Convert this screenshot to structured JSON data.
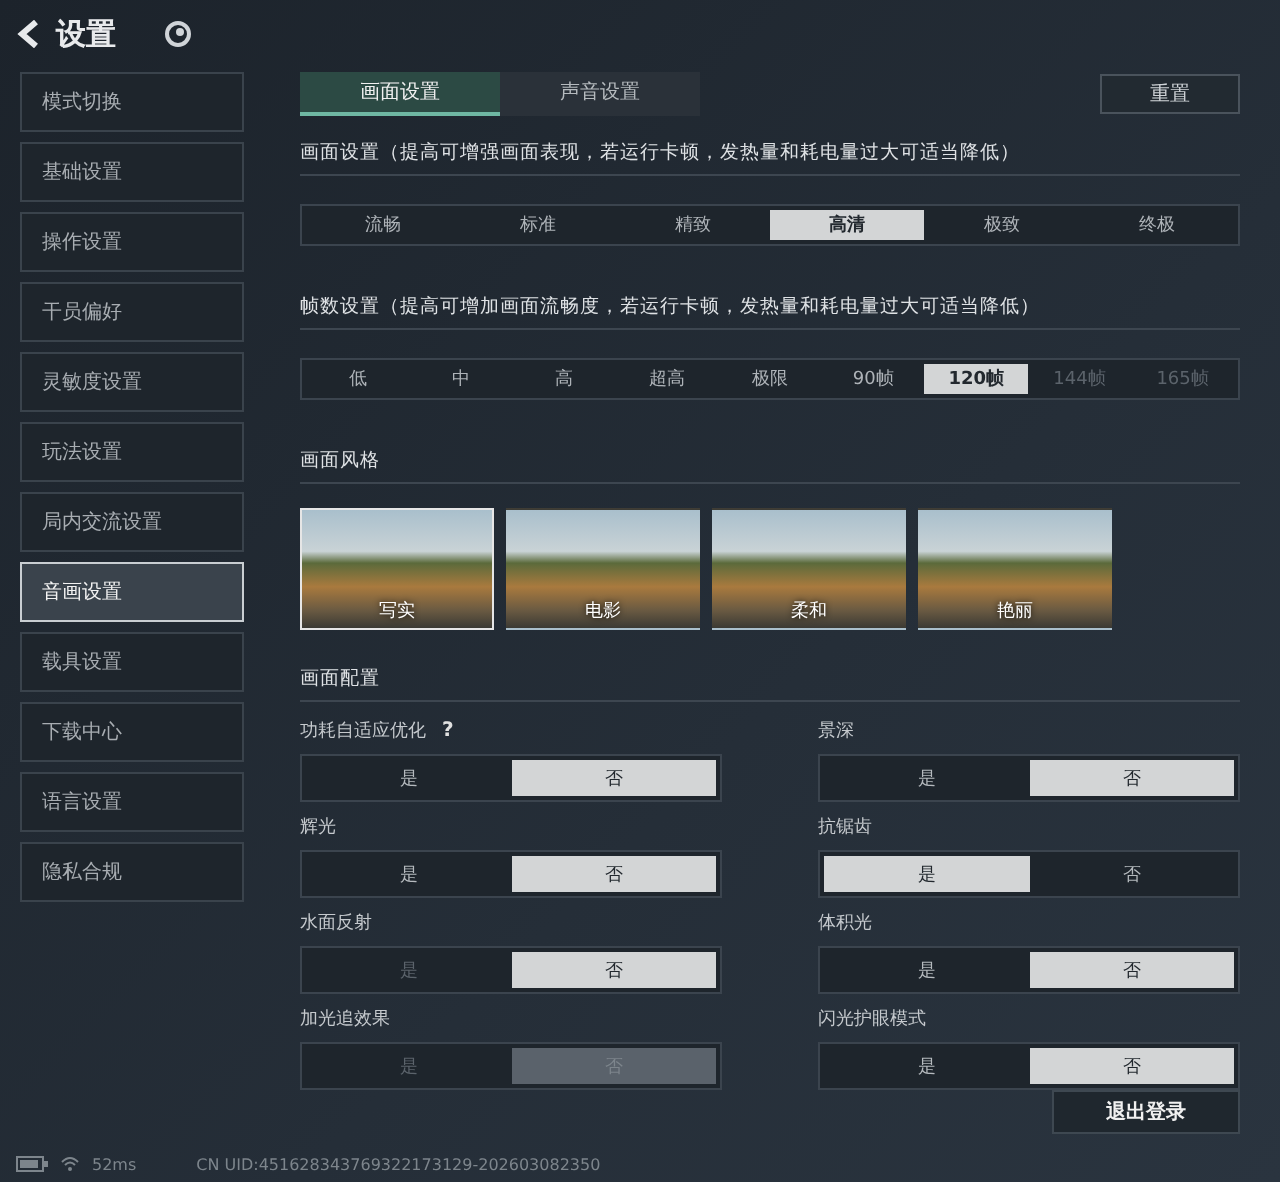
{
  "header": {
    "title": "设置"
  },
  "sidebar": {
    "items": [
      {
        "label": "模式切换",
        "selected": false
      },
      {
        "label": "基础设置",
        "selected": false
      },
      {
        "label": "操作设置",
        "selected": false
      },
      {
        "label": "干员偏好",
        "selected": false
      },
      {
        "label": "灵敏度设置",
        "selected": false
      },
      {
        "label": "玩法设置",
        "selected": false
      },
      {
        "label": "局内交流设置",
        "selected": false
      },
      {
        "label": "音画设置",
        "selected": true
      },
      {
        "label": "载具设置",
        "selected": false
      },
      {
        "label": "下载中心",
        "selected": false
      },
      {
        "label": "语言设置",
        "selected": false
      },
      {
        "label": "隐私合规",
        "selected": false
      }
    ]
  },
  "tabs": [
    {
      "label": "画面设置",
      "selected": true
    },
    {
      "label": "声音设置",
      "selected": false
    }
  ],
  "reset_button": "重置",
  "quality": {
    "title": "画面设置（提高可增强画面表现，若运行卡顿，发热量和耗电量过大可适当降低）",
    "options": [
      {
        "label": "流畅",
        "selected": false,
        "disabled": false
      },
      {
        "label": "标准",
        "selected": false,
        "disabled": false
      },
      {
        "label": "精致",
        "selected": false,
        "disabled": false
      },
      {
        "label": "高清",
        "selected": true,
        "disabled": false
      },
      {
        "label": "极致",
        "selected": false,
        "disabled": false
      },
      {
        "label": "终极",
        "selected": false,
        "disabled": false
      }
    ]
  },
  "frame_rate": {
    "title": "帧数设置（提高可增加画面流畅度，若运行卡顿，发热量和耗电量过大可适当降低）",
    "options": [
      {
        "label": "低",
        "selected": false,
        "disabled": false
      },
      {
        "label": "中",
        "selected": false,
        "disabled": false
      },
      {
        "label": "高",
        "selected": false,
        "disabled": false
      },
      {
        "label": "超高",
        "selected": false,
        "disabled": false
      },
      {
        "label": "极限",
        "selected": false,
        "disabled": false
      },
      {
        "label": "90帧",
        "selected": false,
        "disabled": false
      },
      {
        "label": "120帧",
        "selected": true,
        "disabled": false
      },
      {
        "label": "144帧",
        "selected": false,
        "disabled": true
      },
      {
        "label": "165帧",
        "selected": false,
        "disabled": true
      }
    ]
  },
  "style": {
    "title": "画面风格",
    "options": [
      {
        "label": "写实",
        "selected": true
      },
      {
        "label": "电影",
        "selected": false
      },
      {
        "label": "柔和",
        "selected": false
      },
      {
        "label": "艳丽",
        "selected": false
      }
    ]
  },
  "config": {
    "title": "画面配置",
    "items": [
      {
        "label": "功耗自适应优化",
        "help": "?",
        "options": [
          {
            "label": "是",
            "selected": false,
            "disabled": false
          },
          {
            "label": "否",
            "selected": true,
            "disabled": false
          }
        ]
      },
      {
        "label": "景深",
        "options": [
          {
            "label": "是",
            "selected": false,
            "disabled": false
          },
          {
            "label": "否",
            "selected": true,
            "disabled": false
          }
        ]
      },
      {
        "label": "辉光",
        "options": [
          {
            "label": "是",
            "selected": false,
            "disabled": false
          },
          {
            "label": "否",
            "selected": true,
            "disabled": false
          }
        ]
      },
      {
        "label": "抗锯齿",
        "options": [
          {
            "label": "是",
            "selected": true,
            "disabled": false
          },
          {
            "label": "否",
            "selected": false,
            "disabled": false
          }
        ]
      },
      {
        "label": "水面反射",
        "options": [
          {
            "label": "是",
            "selected": false,
            "disabled": true
          },
          {
            "label": "否",
            "selected": true,
            "disabled": false
          }
        ]
      },
      {
        "label": "体积光",
        "options": [
          {
            "label": "是",
            "selected": false,
            "disabled": false
          },
          {
            "label": "否",
            "selected": true,
            "disabled": false
          }
        ]
      },
      {
        "label": "加光追效果",
        "options": [
          {
            "label": "是",
            "selected": false,
            "disabled": true
          },
          {
            "label": "否",
            "selected": true,
            "disabled": true
          }
        ]
      },
      {
        "label": "闪光护眼模式",
        "options": [
          {
            "label": "是",
            "selected": false,
            "disabled": false
          },
          {
            "label": "否",
            "selected": true,
            "disabled": false
          }
        ]
      }
    ]
  },
  "logout_button": "退出登录",
  "status_bar": {
    "ping": "52ms",
    "uid": "CN UID:451628343769322173129-202603082350"
  }
}
